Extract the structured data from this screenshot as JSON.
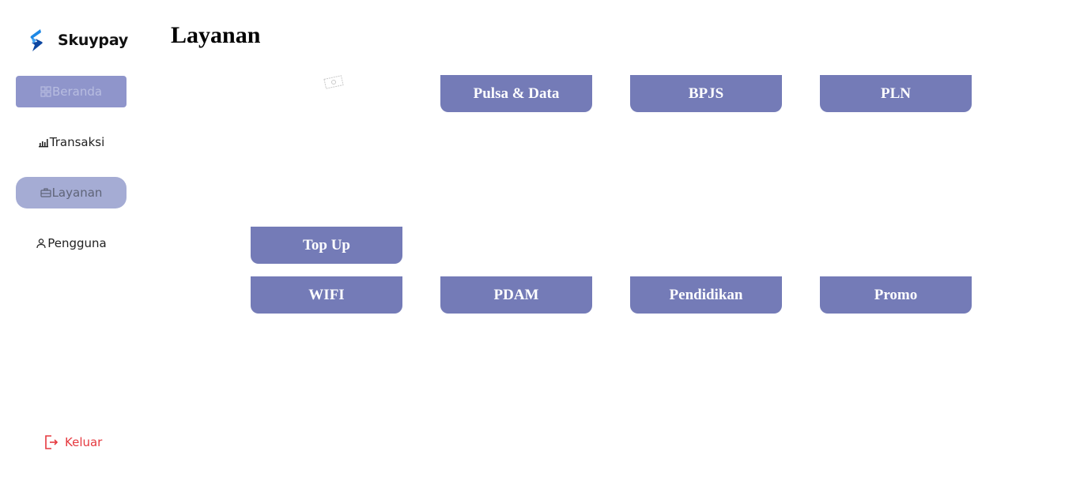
{
  "brand": {
    "name": "Skuypay",
    "logo_icon": "skuypay-logo-icon",
    "colors": [
      "#1e88e5",
      "#0d47a1"
    ]
  },
  "sidebar": {
    "items": [
      {
        "label": "Beranda",
        "icon": "grid-icon"
      },
      {
        "label": "Transaksi",
        "icon": "bar-chart-icon"
      },
      {
        "label": "Layanan",
        "icon": "briefcase-icon",
        "active": true
      },
      {
        "label": "Pengguna",
        "icon": "user-icon"
      }
    ],
    "logout": {
      "label": "Keluar",
      "icon": "logout-icon",
      "color": "#e5393f"
    }
  },
  "main": {
    "title": "Layanan",
    "services": [
      {
        "label": "Pulsa & Data"
      },
      {
        "label": "BPJS"
      },
      {
        "label": "PLN"
      },
      {
        "label": "Top Up"
      },
      {
        "label": "WIFI"
      },
      {
        "label": "PDAM"
      },
      {
        "label": "Pendidikan"
      },
      {
        "label": "Promo"
      }
    ]
  },
  "colors": {
    "service_button": "#747bb7",
    "active_nav": "#a5acd4",
    "beranda_nav": "#8f95cb",
    "logout": "#e5393f"
  }
}
